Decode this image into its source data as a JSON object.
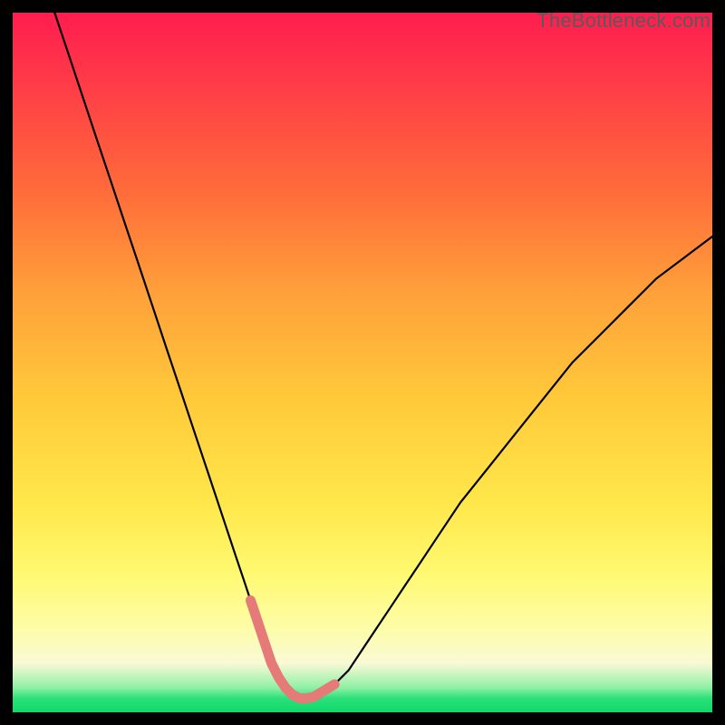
{
  "watermark": "TheBottleneck.com",
  "colors": {
    "curve_stroke": "#000000",
    "highlight_stroke": "#e67a79",
    "highlight_fill": "none"
  },
  "chart_data": {
    "type": "line",
    "title": "",
    "xlabel": "",
    "ylabel": "",
    "xlim": [
      0,
      100
    ],
    "ylim": [
      0,
      100
    ],
    "x": [
      6,
      8,
      10,
      12,
      14,
      16,
      18,
      20,
      22,
      24,
      26,
      28,
      30,
      32,
      33,
      34,
      35,
      36,
      37,
      38,
      39,
      40,
      41,
      42,
      43,
      44,
      46,
      48,
      50,
      52,
      54,
      56,
      58,
      60,
      64,
      68,
      72,
      76,
      80,
      84,
      88,
      92,
      96,
      100
    ],
    "values": [
      100,
      94,
      88,
      82,
      76,
      70,
      64,
      58,
      52,
      46,
      40,
      34,
      28,
      22,
      19,
      16,
      13,
      10,
      7,
      5,
      3.5,
      2.5,
      2,
      2,
      2.2,
      2.8,
      4,
      6,
      9,
      12,
      15,
      18,
      21,
      24,
      30,
      35,
      40,
      45,
      50,
      54,
      58,
      62,
      65,
      68
    ],
    "series": [
      {
        "name": "bottleneck-curve",
        "x_ref": "x",
        "y_ref": "values"
      }
    ],
    "annotations": [
      {
        "name": "optimal-range-highlight",
        "x_start": 34,
        "x_end": 46,
        "style": "thick-pale-red"
      }
    ]
  }
}
